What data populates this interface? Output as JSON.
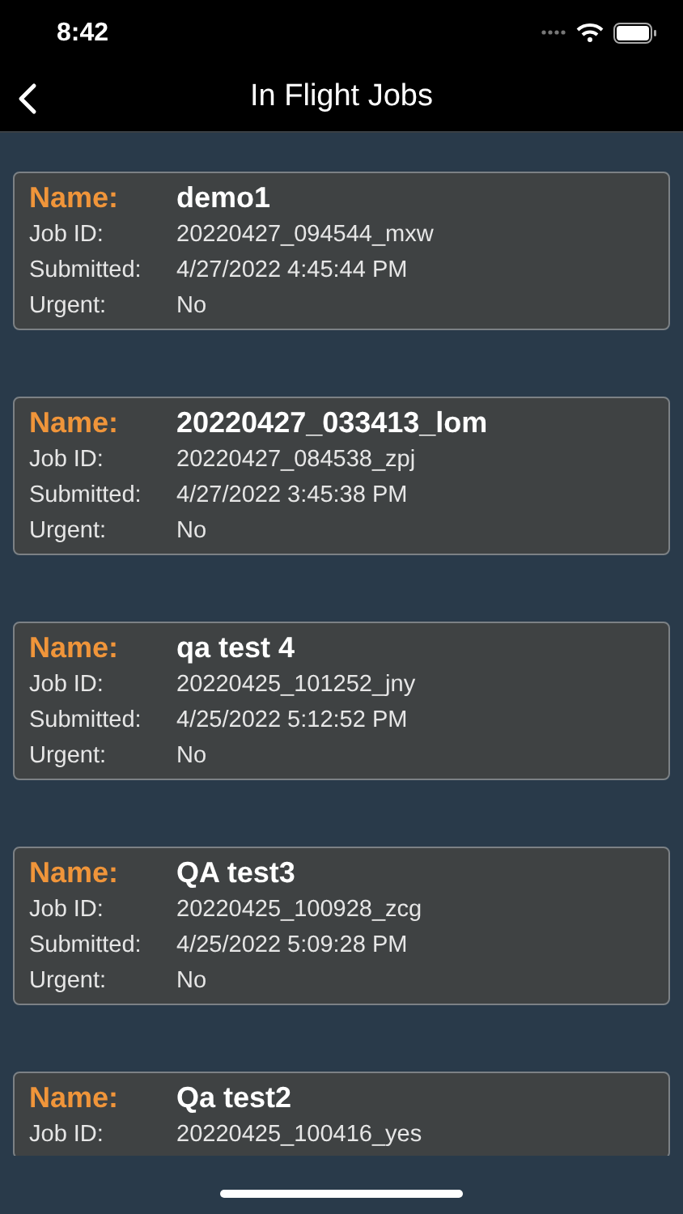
{
  "status_bar": {
    "time": "8:42"
  },
  "nav": {
    "title": "In Flight Jobs"
  },
  "jobs": [
    {
      "name_label": "Name:",
      "name": "demo1",
      "fields": [
        {
          "label": "Job ID:",
          "value": "20220427_094544_mxw"
        },
        {
          "label": "Submitted:",
          "value": "4/27/2022 4:45:44 PM"
        },
        {
          "label": "Urgent:",
          "value": "No"
        }
      ]
    },
    {
      "name_label": "Name:",
      "name": "20220427_033413_lom",
      "fields": [
        {
          "label": "Job ID:",
          "value": "20220427_084538_zpj"
        },
        {
          "label": "Submitted:",
          "value": "4/27/2022 3:45:38 PM"
        },
        {
          "label": "Urgent:",
          "value": "No"
        }
      ]
    },
    {
      "name_label": "Name:",
      "name": "qa test 4",
      "fields": [
        {
          "label": "Job ID:",
          "value": "20220425_101252_jny"
        },
        {
          "label": "Submitted:",
          "value": "4/25/2022 5:12:52 PM"
        },
        {
          "label": "Urgent:",
          "value": "No"
        }
      ]
    },
    {
      "name_label": "Name:",
      "name": "QA test3",
      "fields": [
        {
          "label": "Job ID:",
          "value": "20220425_100928_zcg"
        },
        {
          "label": "Submitted:",
          "value": "4/25/2022 5:09:28 PM"
        },
        {
          "label": "Urgent:",
          "value": "No"
        }
      ]
    },
    {
      "name_label": "Name:",
      "name": "Qa test2",
      "fields": [
        {
          "label": "Job ID:",
          "value": "20220425_100416_yes"
        }
      ]
    }
  ]
}
